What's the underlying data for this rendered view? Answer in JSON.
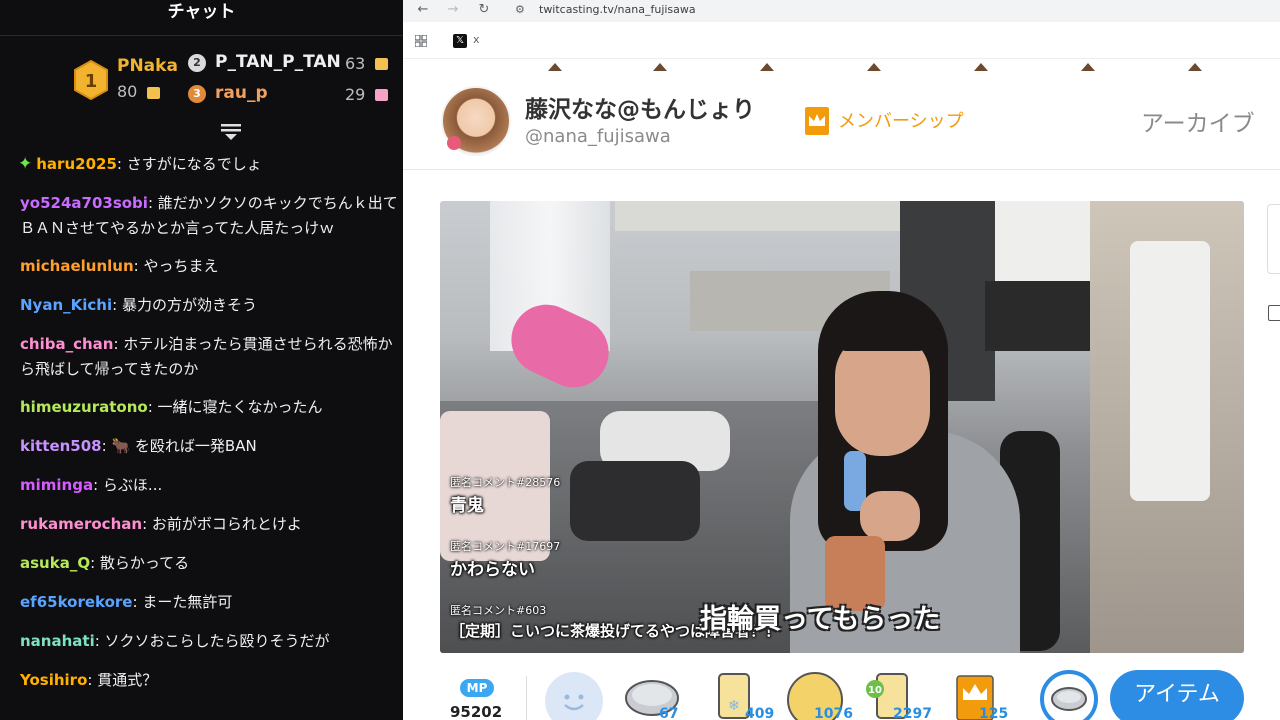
{
  "chat": {
    "title": "チャット",
    "leaderboard": {
      "first": {
        "rank": "1",
        "name": "PNaka",
        "score": "80"
      },
      "second": {
        "rank": "2",
        "name": "P_TAN_P_TAN",
        "score": "63"
      },
      "third": {
        "rank": "3",
        "name": "rau_p",
        "score": "29"
      }
    },
    "messages": [
      {
        "user": "haru2025",
        "text": "さすがになるでしょ",
        "color": "#ffb000"
      },
      {
        "user": "yo524a703sobi",
        "text": "誰だかソクソのキックでちんｋ出てＢＡＮさせてやるかとか言ってた人居たっけｗ",
        "color": "#c86bff"
      },
      {
        "user": "michaelunlun",
        "text": "やっちまえ",
        "color": "#ff9f2e"
      },
      {
        "user": "Nyan_Kichi",
        "text": "暴力の方が効きそう",
        "color": "#5aa3ff"
      },
      {
        "user": "chiba_chan",
        "text": "ホテル泊まったら貫通させられる恐怖から飛ばして帰ってきたのか",
        "color": "#ff8fd1"
      },
      {
        "user": "himeuzuratono",
        "text": "一緒に寝たくなかったん",
        "color": "#b5e85a"
      },
      {
        "user": "kitten508",
        "text": "🐂 を殴れば一発BAN",
        "color": "#c792ff"
      },
      {
        "user": "miminga",
        "text": "らぶほ...",
        "color": "#d65cff"
      },
      {
        "user": "rukamerochan",
        "text": "お前がボコられとけよ",
        "color": "#ff8fd1"
      },
      {
        "user": "asuka_Q",
        "text": "散らかってる",
        "color": "#b5e85a"
      },
      {
        "user": "ef65korekore",
        "text": "まーた無許可",
        "color": "#5aa3ff"
      },
      {
        "user": "nanahati",
        "text": "ソクソおこらしたら殴りそうだが",
        "color": "#7ee0c4"
      },
      {
        "user": "Yosihiro",
        "text": "貫通式？",
        "color": "#ffb000"
      }
    ]
  },
  "browser": {
    "url": "twitcasting.tv/nana_fujisawa",
    "bookmark_x_label": "x",
    "streamer_name": "藤沢なな@もんじょり",
    "streamer_handle": "@nana_fujisawa",
    "membership_label": "メンバーシップ",
    "archive_label": "アーカイブ"
  },
  "video": {
    "comments": [
      {
        "tag": "匿名コメント#28576",
        "text": "青鬼"
      },
      {
        "tag": "匿名コメント#17697",
        "text": "かわらない"
      },
      {
        "tag": "匿名コメント#603",
        "text": "［定期］こいつに茶爆投げてるやつは障害者！！"
      }
    ],
    "subtitle": "指輪買ってもらった"
  },
  "items_bar": {
    "mp_label": "MP",
    "mp_value": "95202",
    "items": [
      {
        "name": "coin",
        "count": "67"
      },
      {
        "name": "cup",
        "count": "409"
      },
      {
        "name": "ball",
        "count": "1076"
      },
      {
        "name": "cup-10",
        "count": "2297",
        "badge": "10"
      },
      {
        "name": "crown-card",
        "count": "125"
      }
    ],
    "item_button_label": "アイテム"
  }
}
